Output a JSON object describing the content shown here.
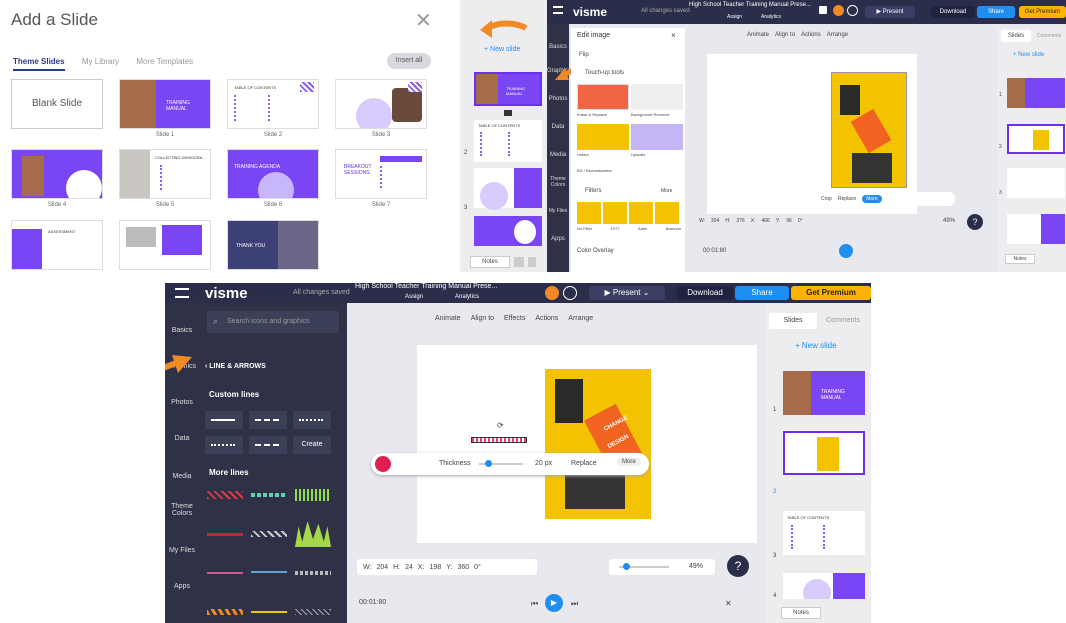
{
  "panelA": {
    "title": "Add a Slide",
    "tabs": [
      "Theme Slides",
      "My Library",
      "More Templates"
    ],
    "insert_all": "Insert all",
    "blank": "Blank Slide",
    "slides": [
      "Slide 1",
      "Slide 2",
      "Slide 3",
      "Slide 4",
      "Slide 5",
      "Slide 6",
      "Slide 7"
    ],
    "thumb_texts": {
      "s1": "TRAINING MANUAL",
      "s2": "TABLE OF CONTENTS",
      "s5": "COLLECTING DEMOGRA...",
      "s6": "TRAINING AGENDA",
      "s7": "BREAKOUT SESSIONS",
      "s8": "ASSESSMENT",
      "s10": "THANK YOU"
    }
  },
  "panelB": {
    "new_slide": "+ New slide",
    "thumb1": "TRAINING MANUAL",
    "thumb2": "TABLE OF CONTENTS",
    "numbers": [
      "2",
      "3"
    ],
    "notes": "Notes"
  },
  "panelC": {
    "logo": "visme",
    "saved": "All changes saved",
    "doc_title": "High School Teacher Training Manual Prese...",
    "assign": "Assign",
    "analytics": "Analytics",
    "present": "Present",
    "download": "Download",
    "share": "Share",
    "premium": "Get Premium",
    "sidebar": [
      "Basics",
      "Graphics",
      "Photos",
      "Data",
      "Media",
      "Theme Colors",
      "My Files",
      "Apps"
    ],
    "edit_image": "Edit image",
    "flip": "Flip",
    "touchup": "Touch-up tools",
    "tools": [
      "Erase & Replace",
      "Background Remover",
      "Unblur",
      "Upscale"
    ],
    "bw": "BG / Blur/saturation",
    "filters": "Filters",
    "more": "More",
    "filter_names": [
      "No Filter",
      "1977",
      "Aden",
      "Brannan"
    ],
    "overlay": "Color Overlay",
    "toolbar": [
      "Animate",
      "Align to",
      "Actions",
      "Arrange"
    ],
    "crop": "Crop",
    "replace": "Replace",
    "morebtn": "More",
    "w": "304",
    "h": "376",
    "x": "466",
    "y": "96",
    "rot": "0°",
    "zoom": "49%",
    "time": "00:01:80",
    "slides_tab": "Slides",
    "comments_tab": "Comments",
    "new_slide": "+ New slide",
    "notes": "Notes",
    "nums": [
      "1",
      "2",
      "3"
    ],
    "thumb1": "TRAINING MANUAL",
    "thumb3": "TABLE OF CONTENTS"
  },
  "panelD": {
    "logo": "visme",
    "saved": "All changes saved",
    "doc_title": "High School Teacher Training Manual Prese...",
    "assign": "Assign",
    "analytics": "Analytics",
    "present": "Present",
    "download": "Download",
    "share": "Share",
    "premium": "Get Premium",
    "sidebar": [
      "Basics",
      "Graphics",
      "Photos",
      "Data",
      "Media",
      "Theme Colors",
      "My Files",
      "Apps"
    ],
    "search_placeholder": "Search icons and graphics",
    "back": "LINE & ARROWS",
    "custom_lines": "Custom lines",
    "create": "Create",
    "more_lines": "More lines",
    "toolbar": [
      "Animate",
      "Align to",
      "Effects",
      "Actions",
      "Arrange"
    ],
    "thickness": "Thickness",
    "px": "20 px",
    "replace": "Replace",
    "morebtn": "More",
    "w": "204",
    "h": "24",
    "x": "198",
    "y": "360",
    "rot": "0°",
    "zoom": "49%",
    "time": "00:01:80",
    "slides_tab": "Slides",
    "comments_tab": "Comments",
    "new_slide": "+ New slide",
    "notes": "Notes",
    "nums": [
      "1",
      "2",
      "3",
      "4"
    ],
    "thumb1": "TRAINING MANUAL",
    "thumb3": "TABLE OF CONTENTS",
    "change": "CHANGE",
    "design": "DESIGN"
  },
  "colors": {
    "accent": "#6d2ff0",
    "orange_arrow": "#f08a24",
    "topbar": "#2b2e4a",
    "blue": "#1f8ef1",
    "premium": "#ffb300"
  }
}
